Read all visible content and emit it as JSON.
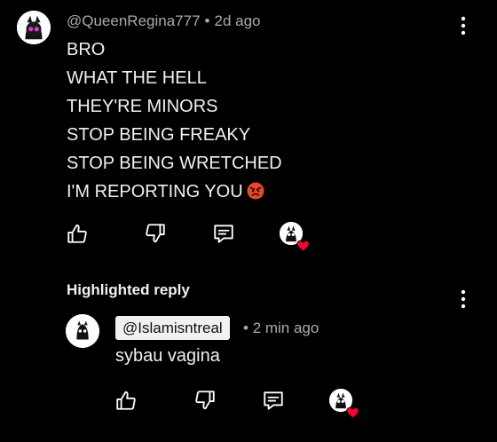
{
  "comment": {
    "author": "@QueenRegina777",
    "separator": "•",
    "time": "2d ago",
    "lines": [
      "BRO",
      "WHAT THE HELL",
      "THEY'RE MINORS",
      "STOP BEING FREAKY",
      "STOP BEING WRETCHED",
      "I'M REPORTING YOU"
    ],
    "emoji": "angry-face-emoji",
    "actions": [
      "like-icon",
      "dislike-icon",
      "reply-icon",
      "creator-heart-icon"
    ]
  },
  "highlighted": {
    "section_title": "Highlighted reply",
    "author": "@Islamisntreal",
    "separator": "•",
    "time": "2 min ago",
    "text": "sybau vagina",
    "actions": [
      "like-icon",
      "dislike-icon",
      "reply-icon",
      "creator-heart-icon"
    ]
  },
  "colors": {
    "background": "#000000",
    "text": "#f1f1f1",
    "meta": "#aaaaaa",
    "heart": "#ff0033",
    "chip_bg": "#f1f1f1"
  }
}
